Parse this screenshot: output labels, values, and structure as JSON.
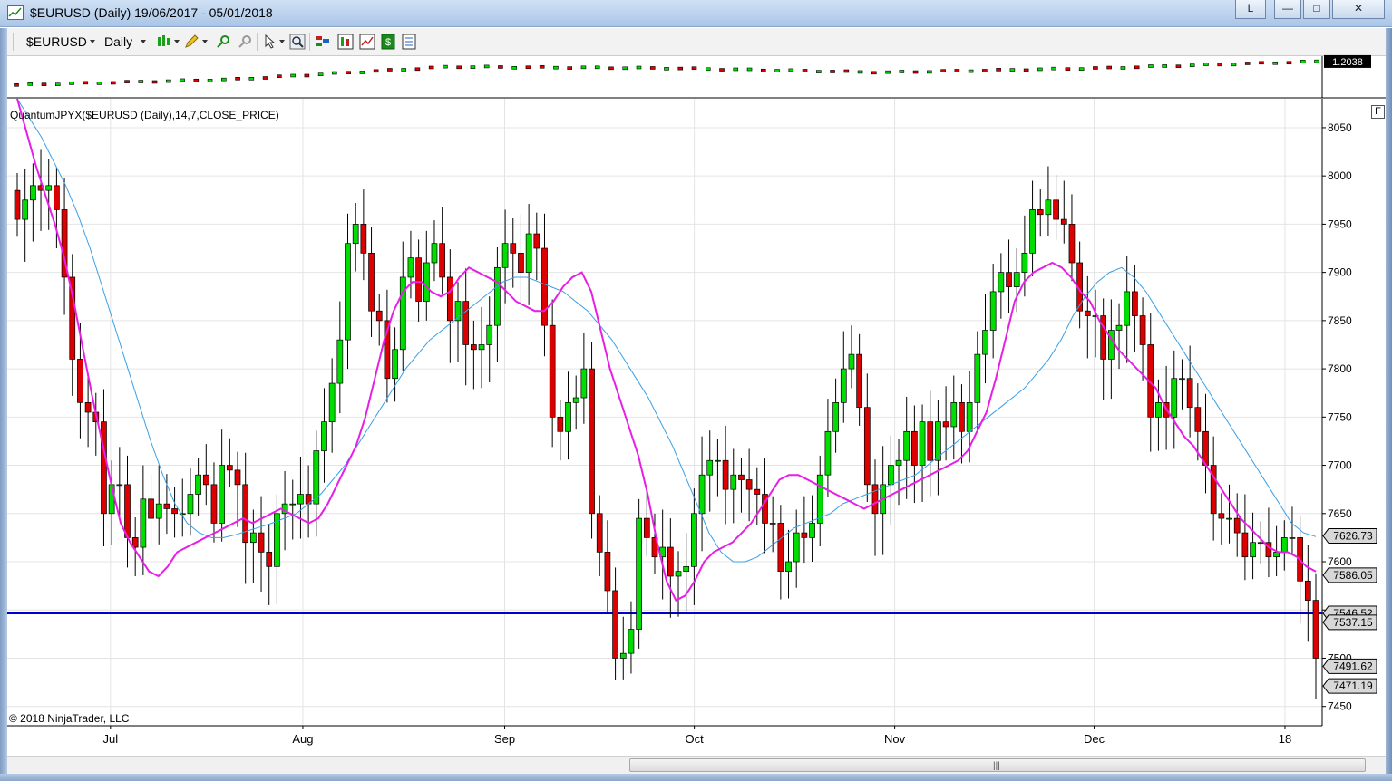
{
  "window": {
    "title": "$EURUSD (Daily)  19/06/2017 - 05/01/2018",
    "buttons": {
      "layout": "L",
      "minimize": "—",
      "restore": "□",
      "close": "✕"
    }
  },
  "toolbar": {
    "instrument": "$EURUSD",
    "interval": "Daily",
    "icons": [
      "bar-type-icon",
      "pencil-draw-icon",
      "zoom-in-icon",
      "zoom-out-icon",
      "cursor-icon",
      "magnifier-icon",
      "strategies-icon",
      "indicators-icon",
      "chart-style-icon",
      "data-box-icon",
      "properties-icon"
    ]
  },
  "price_panel": {
    "last_label": "1.2038"
  },
  "indicator": {
    "label": "QuantumJPYX($EURUSD  (Daily),14,7,CLOSE_PRICE)",
    "f_button": "F",
    "copyright": "© 2018 NinjaTrader, LLC",
    "price_tags": [
      "7626.73",
      "7586.05",
      "7546.52",
      "7537.15",
      "7491.62",
      "7471.19"
    ],
    "colors": {
      "up": "#00dd00",
      "down": "#dd0000",
      "fast_ma": "#e61ee6",
      "slow_ma": "#3a9fe6",
      "hline": "#0000cc"
    }
  },
  "scrollbar": {
    "grip": "|||"
  },
  "chart_data": [
    {
      "type": "line",
      "title": "$EURUSD",
      "x": [
        "Jul",
        "Aug",
        "Sep",
        "Oct",
        "Nov",
        "Dec",
        "18"
      ],
      "series": [
        {
          "values": [
            1.12,
            1.14,
            1.185,
            1.18,
            1.165,
            1.18,
            1.2038
          ]
        }
      ]
    },
    {
      "type": "candlestick",
      "title": "QuantumJPYX($EURUSD  (Daily),14,7,CLOSE_PRICE)",
      "x_ticks": [
        "Jul",
        "Aug",
        "Sep",
        "Oct",
        "Nov",
        "Dec",
        "18"
      ],
      "y_ticks": [
        8050,
        8000,
        7950,
        7900,
        7850,
        7800,
        7750,
        7700,
        7650,
        7600,
        7550,
        7500,
        7450
      ],
      "ylim": [
        7430,
        8080
      ],
      "horizontal_line": 7547,
      "series": [
        {
          "name": "close",
          "values": [
            7955,
            7975,
            7990,
            7985,
            7990,
            7965,
            7895,
            7810,
            7765,
            7755,
            7745,
            7650,
            7680,
            7680,
            7625,
            7615,
            7665,
            7645,
            7660,
            7655,
            7650,
            7650,
            7670,
            7690,
            7680,
            7640,
            7700,
            7695,
            7680,
            7620,
            7630,
            7610,
            7595,
            7650,
            7660,
            7660,
            7670,
            7660,
            7715,
            7745,
            7785,
            7830,
            7930,
            7950,
            7920,
            7860,
            7850,
            7790,
            7820,
            7895,
            7915,
            7870,
            7910,
            7930,
            7895,
            7850,
            7870,
            7825,
            7820,
            7825,
            7845,
            7905,
            7930,
            7920,
            7900,
            7940,
            7925,
            7845,
            7750,
            7735,
            7765,
            7770,
            7800,
            7650,
            7610,
            7570,
            7500,
            7505,
            7530,
            7645,
            7625,
            7605,
            7615,
            7585,
            7590,
            7595,
            7650,
            7690,
            7705,
            7705,
            7675,
            7690,
            7685,
            7675,
            7670,
            7640,
            7640,
            7590,
            7600,
            7630,
            7625,
            7640,
            7690,
            7735,
            7765,
            7800,
            7815,
            7760,
            7680,
            7650,
            7680,
            7700,
            7705,
            7735,
            7700,
            7745,
            7705,
            7745,
            7740,
            7765,
            7735,
            7765,
            7815,
            7840,
            7880,
            7900,
            7885,
            7900,
            7920,
            7965,
            7960,
            7975,
            7955,
            7950,
            7910,
            7860,
            7855,
            7855,
            7810,
            7840,
            7845,
            7880,
            7855,
            7825,
            7750,
            7765,
            7750,
            7790,
            7790,
            7760,
            7735,
            7700,
            7650,
            7645,
            7645,
            7630,
            7605,
            7620,
            7620,
            7605,
            7610,
            7625,
            7625,
            7580,
            7560,
            7500
          ]
        },
        {
          "name": "fast",
          "values": [
            8080,
            8045,
            8010,
            7980,
            7950,
            7915,
            7870,
            7820,
            7770,
            7725,
            7680,
            7640,
            7620,
            7605,
            7590,
            7585,
            7595,
            7610,
            7615,
            7620,
            7625,
            7630,
            7635,
            7640,
            7645,
            7640,
            7645,
            7650,
            7655,
            7650,
            7645,
            7640,
            7645,
            7660,
            7680,
            7700,
            7720,
            7750,
            7790,
            7830,
            7860,
            7880,
            7890,
            7890,
            7880,
            7875,
            7880,
            7895,
            7905,
            7900,
            7895,
            7890,
            7880,
            7870,
            7865,
            7860,
            7860,
            7870,
            7885,
            7895,
            7900,
            7880,
            7840,
            7800,
            7770,
            7740,
            7710,
            7670,
            7620,
            7580,
            7560,
            7565,
            7580,
            7600,
            7610,
            7615,
            7620,
            7630,
            7640,
            7655,
            7670,
            7685,
            7690,
            7690,
            7685,
            7680,
            7675,
            7670,
            7665,
            7660,
            7655,
            7660,
            7665,
            7670,
            7675,
            7680,
            7685,
            7690,
            7695,
            7700,
            7705,
            7715,
            7735,
            7755,
            7790,
            7830,
            7870,
            7890,
            7900,
            7905,
            7910,
            7905,
            7895,
            7880,
            7870,
            7850,
            7835,
            7820,
            7810,
            7800,
            7790,
            7780,
            7760,
            7745,
            7730,
            7720,
            7705,
            7690,
            7675,
            7660,
            7645,
            7635,
            7625,
            7615,
            7610,
            7610,
            7605,
            7595,
            7590
          ]
        },
        {
          "name": "slow",
          "values": [
            8080,
            8060,
            8040,
            8015,
            7990,
            7960,
            7925,
            7885,
            7845,
            7805,
            7765,
            7725,
            7690,
            7660,
            7640,
            7630,
            7625,
            7625,
            7628,
            7632,
            7636,
            7640,
            7645,
            7650,
            7660,
            7670,
            7685,
            7700,
            7720,
            7740,
            7760,
            7780,
            7800,
            7815,
            7830,
            7840,
            7850,
            7860,
            7870,
            7880,
            7890,
            7895,
            7895,
            7890,
            7885,
            7880,
            7870,
            7860,
            7845,
            7830,
            7810,
            7790,
            7770,
            7745,
            7720,
            7690,
            7660,
            7630,
            7610,
            7600,
            7600,
            7605,
            7615,
            7625,
            7635,
            7640,
            7645,
            7650,
            7660,
            7665,
            7670,
            7675,
            7680,
            7685,
            7690,
            7700,
            7710,
            7720,
            7730,
            7740,
            7750,
            7760,
            7770,
            7780,
            7795,
            7810,
            7830,
            7855,
            7875,
            7890,
            7900,
            7905,
            7895,
            7880,
            7860,
            7840,
            7820,
            7800,
            7780,
            7760,
            7740,
            7720,
            7700,
            7680,
            7660,
            7640,
            7630,
            7626
          ]
        }
      ]
    }
  ]
}
